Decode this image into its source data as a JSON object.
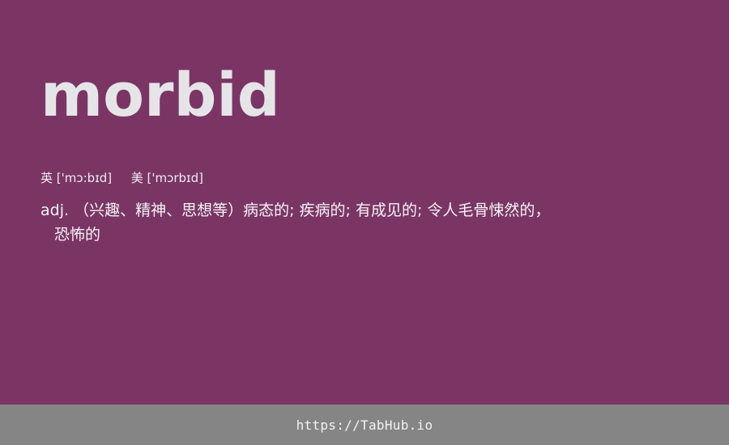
{
  "entry": {
    "word": "morbid",
    "phonetics": {
      "uk_label": "英",
      "uk_ipa": "['mɔ:bɪd]",
      "us_label": "美",
      "us_ipa": "['mɔrbɪd]"
    },
    "definition": {
      "pos": "adj.",
      "line1": "（兴趣、精神、思想等）病态的; 疾病的; 有成见的; 令人毛骨悚然的，",
      "line2": "恐怖的"
    }
  },
  "footer": {
    "link": "https://TabHub.io"
  },
  "colors": {
    "background": "#7b3565",
    "footer_bg": "#858585",
    "word": "#e5e5e7"
  }
}
